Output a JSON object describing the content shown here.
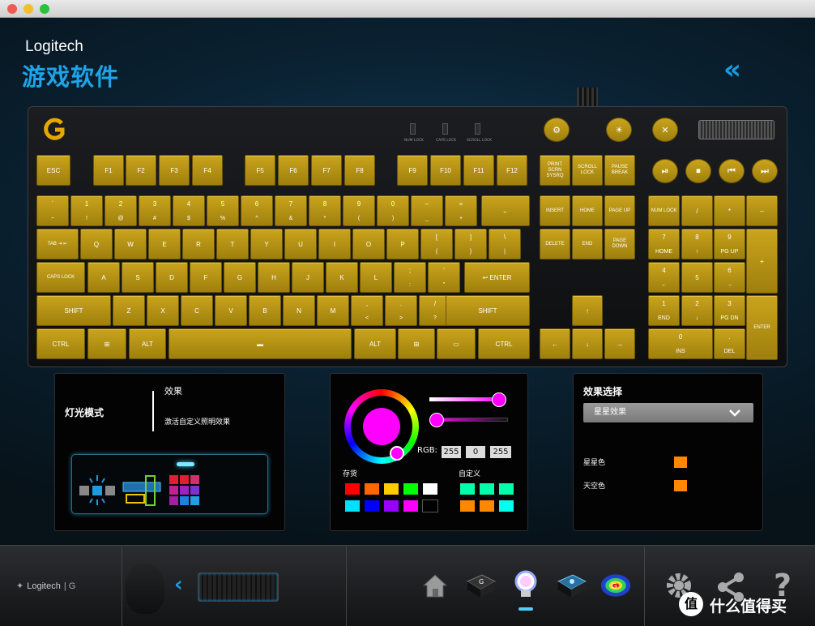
{
  "header": {
    "brand": "Logitech",
    "title": "游戏软件",
    "collapse_icon": "double-chevron-left-icon"
  },
  "locks": [
    "NUM LOCK",
    "CAPS LOCK",
    "SCROLL LOCK"
  ],
  "keyboard": {
    "key_color": "#c9a41c",
    "fn_row": [
      "ESC",
      "F1",
      "F2",
      "F3",
      "F4",
      "F5",
      "F6",
      "F7",
      "F8",
      "F9",
      "F10",
      "F11",
      "F12"
    ],
    "sys": [
      "PRINT SCRN SYSRQ",
      "SCROLL LOCK",
      "PAUSE BREAK"
    ],
    "nav1": [
      "INSERT",
      "HOME",
      "PAGE UP"
    ],
    "nav2": [
      "DELETE",
      "END",
      "PAGE DOWN"
    ],
    "num_top": [
      "NUM LOCK",
      "/",
      "*",
      "–"
    ],
    "row1": [
      [
        "`",
        "~"
      ],
      [
        "1",
        "!"
      ],
      [
        "2",
        "@"
      ],
      [
        "3",
        "#"
      ],
      [
        "4",
        "$"
      ],
      [
        "5",
        "%"
      ],
      [
        "6",
        "^"
      ],
      [
        "7",
        "&"
      ],
      [
        "8",
        "*"
      ],
      [
        "9",
        "("
      ],
      [
        "0",
        ")"
      ],
      [
        "–",
        "_"
      ],
      [
        "=",
        "+"
      ]
    ],
    "backspace": "←",
    "tab": "TAB ⇥ ⇤",
    "row2": [
      "Q",
      "W",
      "E",
      "R",
      "T",
      "Y",
      "U",
      "I",
      "O",
      "P"
    ],
    "row2_br": [
      [
        "[",
        "{"
      ],
      [
        "]",
        "}"
      ],
      [
        "\\",
        "|"
      ]
    ],
    "caps": "CAPS LOCK",
    "row3": [
      "A",
      "S",
      "D",
      "F",
      "G",
      "H",
      "J",
      "K",
      "L"
    ],
    "row3_p": [
      [
        ";",
        ":"
      ],
      [
        "'",
        "\""
      ]
    ],
    "enter": "↩ ENTER",
    "shift": "SHIFT",
    "row4": [
      "Z",
      "X",
      "C",
      "V",
      "B",
      "N",
      "M"
    ],
    "row4_p": [
      [
        ",",
        "<"
      ],
      [
        ".",
        ">"
      ],
      [
        "/",
        "?"
      ]
    ],
    "ctrl": "CTRL",
    "alt": "ALT",
    "space": "▬",
    "arrows": {
      "up": "↑",
      "left": "←",
      "down": "↓",
      "right": "→"
    },
    "num7": [
      "7",
      "HOME"
    ],
    "num8": [
      "8",
      "↑"
    ],
    "num9": [
      "9",
      "PG UP"
    ],
    "numplus": "+",
    "num4": [
      "4",
      "←"
    ],
    "num5": [
      "5",
      ""
    ],
    "num6": [
      "6",
      "→"
    ],
    "num1": [
      "1",
      "END"
    ],
    "num2": [
      "2",
      "↓"
    ],
    "num3": [
      "3",
      "PG DN"
    ],
    "numenter": "ENTER",
    "num0": [
      "0",
      "INS"
    ],
    "numdot": [
      ".",
      "DEL"
    ],
    "media": [
      "⏯",
      "⏹",
      "⏮",
      "⏭"
    ]
  },
  "lighting_mode": {
    "title": "灯光模式",
    "effect_label": "效果",
    "effect_desc": "激活自定义照明效果"
  },
  "color_panel": {
    "rgb_label": "RGB:",
    "r": "255",
    "g": "0",
    "b": "255",
    "selected": "#ff00ff",
    "saved_label": "存货",
    "custom_label": "自定义",
    "saved": [
      "#ff0000",
      "#ff6600",
      "#ffcc00",
      "#00ff00",
      "#ffffff",
      "#00e0ff",
      "#0000ff",
      "#9900ff",
      "#ff00ff",
      "#000000"
    ],
    "custom": [
      "#00ffaa",
      "#00ffaa",
      "#00ffaa",
      "#ff8800",
      "#ff8800",
      "#00ffee"
    ]
  },
  "effect_select": {
    "title": "效果选择",
    "dropdown": "星星效果",
    "star_color_label": "星星色",
    "sky_color_label": "天空色",
    "star_color": "#ff8800",
    "sky_color": "#ff8800"
  },
  "bottom": {
    "brand": "Logitech",
    "watermark": "什么值得买"
  }
}
